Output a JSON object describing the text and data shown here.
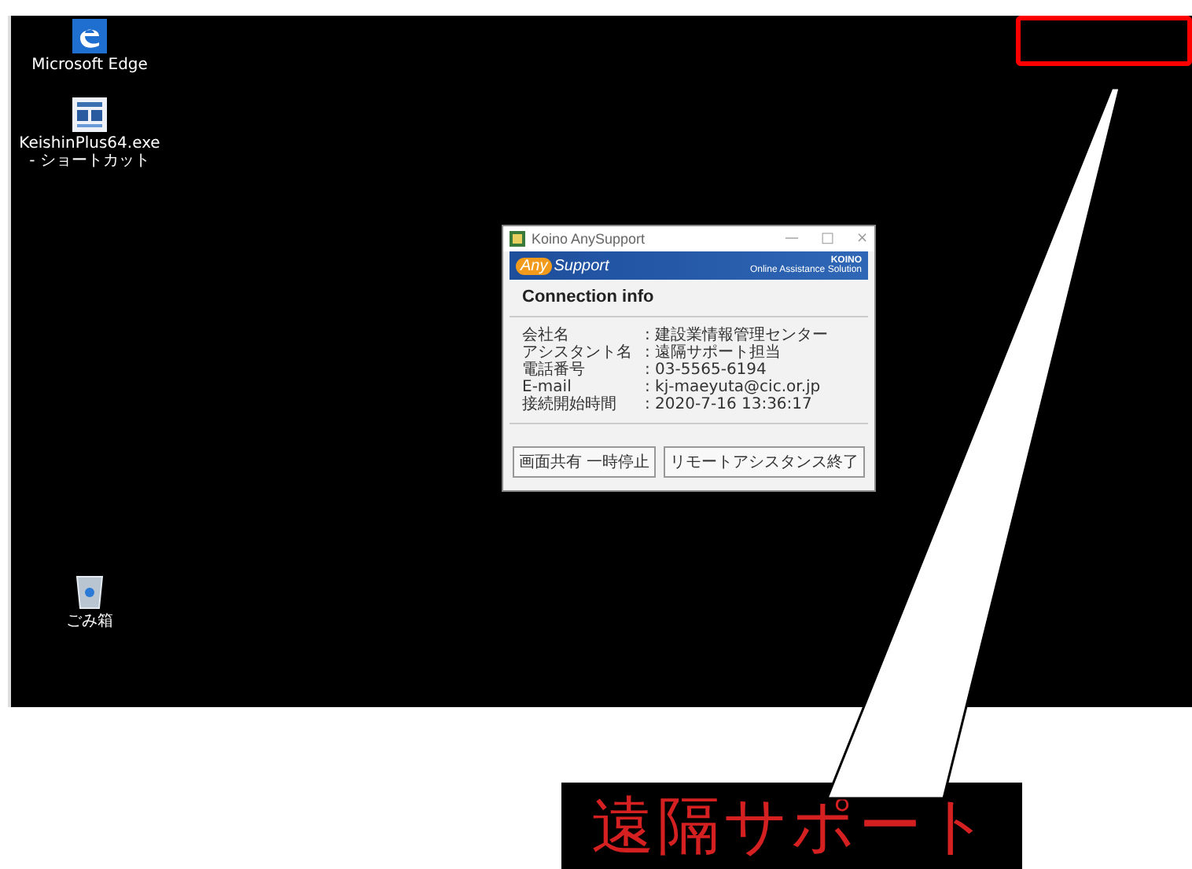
{
  "desktop": {
    "icons": [
      {
        "kind": "edge",
        "label": "Microsoft Edge"
      },
      {
        "kind": "app",
        "label": "KeishinPlus64.exe - ショートカット"
      },
      {
        "kind": "trash",
        "label": "ごみ箱"
      }
    ]
  },
  "dialog": {
    "title": "Koino AnySupport",
    "controls": [
      "—",
      "□",
      "×"
    ],
    "banner": {
      "logo_parts": [
        "Any",
        "Support"
      ],
      "brand": "KOINO",
      "tagline": "Online Assistance Solution"
    },
    "heading": "Connection info",
    "fields": [
      {
        "label": "会社名",
        "value": ": 建設業情報管理センター"
      },
      {
        "label": "アシスタント名",
        "value": ": 遠隔サポート担当"
      },
      {
        "label": "電話番号",
        "value": ": 03-5565-6194"
      },
      {
        "label": "E-mail",
        "value": ": kj-maeyuta@cic.or.jp"
      },
      {
        "label": "接続開始時間",
        "value": ": 2020-7-16 13:36:17"
      }
    ],
    "buttons": [
      "画面共有 一時停止",
      "リモートアシスタンス終了"
    ]
  },
  "callout": {
    "text": "遠隔サポート"
  }
}
